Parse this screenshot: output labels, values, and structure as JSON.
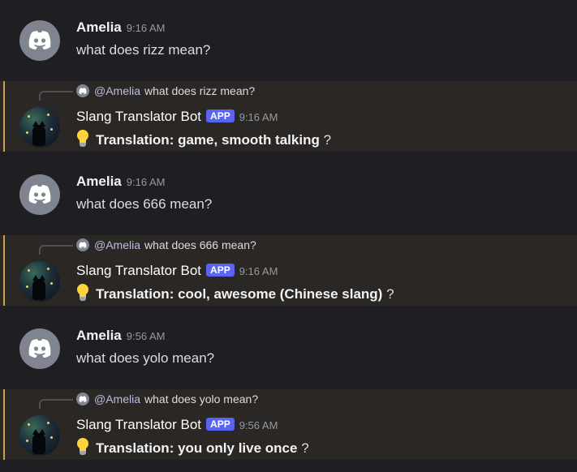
{
  "conversation": [
    {
      "kind": "user",
      "author": "Amelia",
      "time": "9:16 AM",
      "text": "what does rizz mean?"
    },
    {
      "kind": "bot",
      "reply_mention": "@Amelia",
      "reply_text": "what does rizz mean?",
      "author": "Slang Translator Bot",
      "badge": "APP",
      "time": "9:16 AM",
      "label": "Translation",
      "colon": ":",
      "value": "game, smooth talking",
      "suffix": "?"
    },
    {
      "kind": "user",
      "author": "Amelia",
      "time": "9:16 AM",
      "text": "what does 666 mean?"
    },
    {
      "kind": "bot",
      "reply_mention": "@Amelia",
      "reply_text": "what does 666 mean?",
      "author": "Slang Translator Bot",
      "badge": "APP",
      "time": "9:16 AM",
      "label": "Translation",
      "colon": ":",
      "value": "cool, awesome (Chinese slang)",
      "suffix": "?"
    },
    {
      "kind": "user",
      "author": "Amelia",
      "time": "9:56 AM",
      "text": "what does yolo mean?"
    },
    {
      "kind": "bot",
      "reply_mention": "@Amelia",
      "reply_text": "what does yolo mean?",
      "author": "Slang Translator Bot",
      "badge": "APP",
      "time": "9:56 AM",
      "label": "Translation",
      "colon": ":",
      "value": "you only live once",
      "suffix": "?"
    }
  ],
  "icons": {
    "user_avatar": "discord-logo-icon",
    "bot_avatar": "cat-night-sky-avatar",
    "translation_emoji": "light-bulb-icon"
  },
  "colors": {
    "background": "#1f1f23",
    "bot_row_background": "#2a2724",
    "highlight_bar": "#c8a050",
    "app_badge": "#5865f2",
    "timestamp": "#949ba4"
  }
}
